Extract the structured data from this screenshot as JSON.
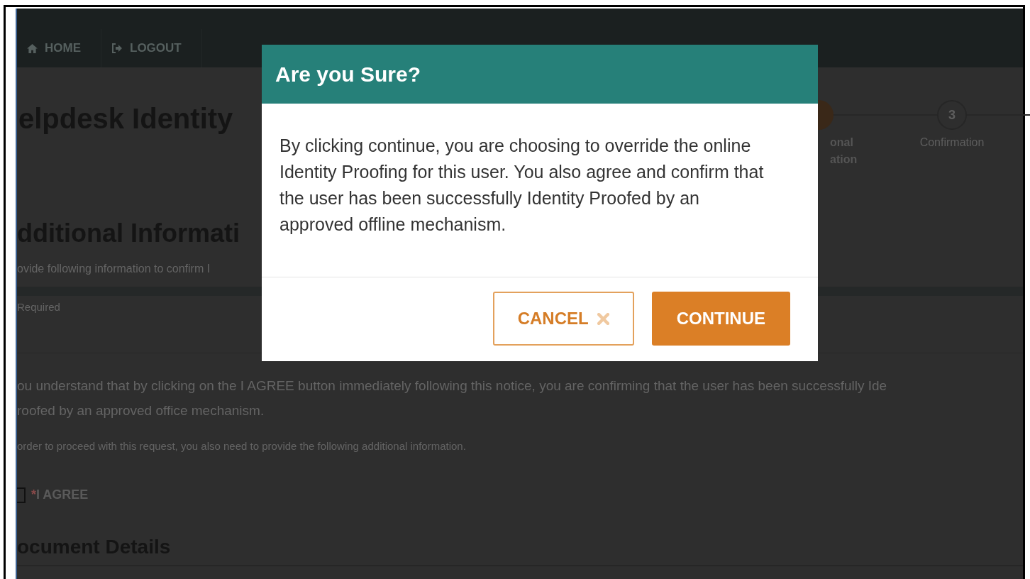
{
  "nav": [
    {
      "label": "HOME"
    },
    {
      "label": "LOGOUT"
    }
  ],
  "page": {
    "title": "elpdesk Identity",
    "steps": [
      {
        "current": true,
        "label_lines": [
          "onal",
          "ation"
        ]
      },
      {
        "current": false,
        "number": "3",
        "label_lines": [
          "Confirmation"
        ]
      }
    ],
    "section_heading": "dditional Informati",
    "instructions": "ovide following information to confirm I",
    "required_note": "Required",
    "notice": [
      "ou understand that by clicking on the I AGREE button immediately following this notice, you are confirming that the user has been successfully Ide",
      "roofed by an approved office mechanism."
    ],
    "additional_note": "order to proceed with this request, you also need to provide the following additional information.",
    "agree": {
      "required_mark": "*",
      "label": "I AGREE",
      "checked": false
    },
    "document_heading": "ocument Details"
  },
  "modal": {
    "title": "Are you Sure?",
    "message": "By clicking continue, you are choosing to override the online Identity Proofing for this user. You also agree and confirm that the user has been successfully Identity Proofed by an approved offline mechanism.",
    "buttons": [
      {
        "label": "CANCEL",
        "kind": "secondary"
      },
      {
        "label": "CONTINUE",
        "kind": "primary"
      }
    ]
  }
}
